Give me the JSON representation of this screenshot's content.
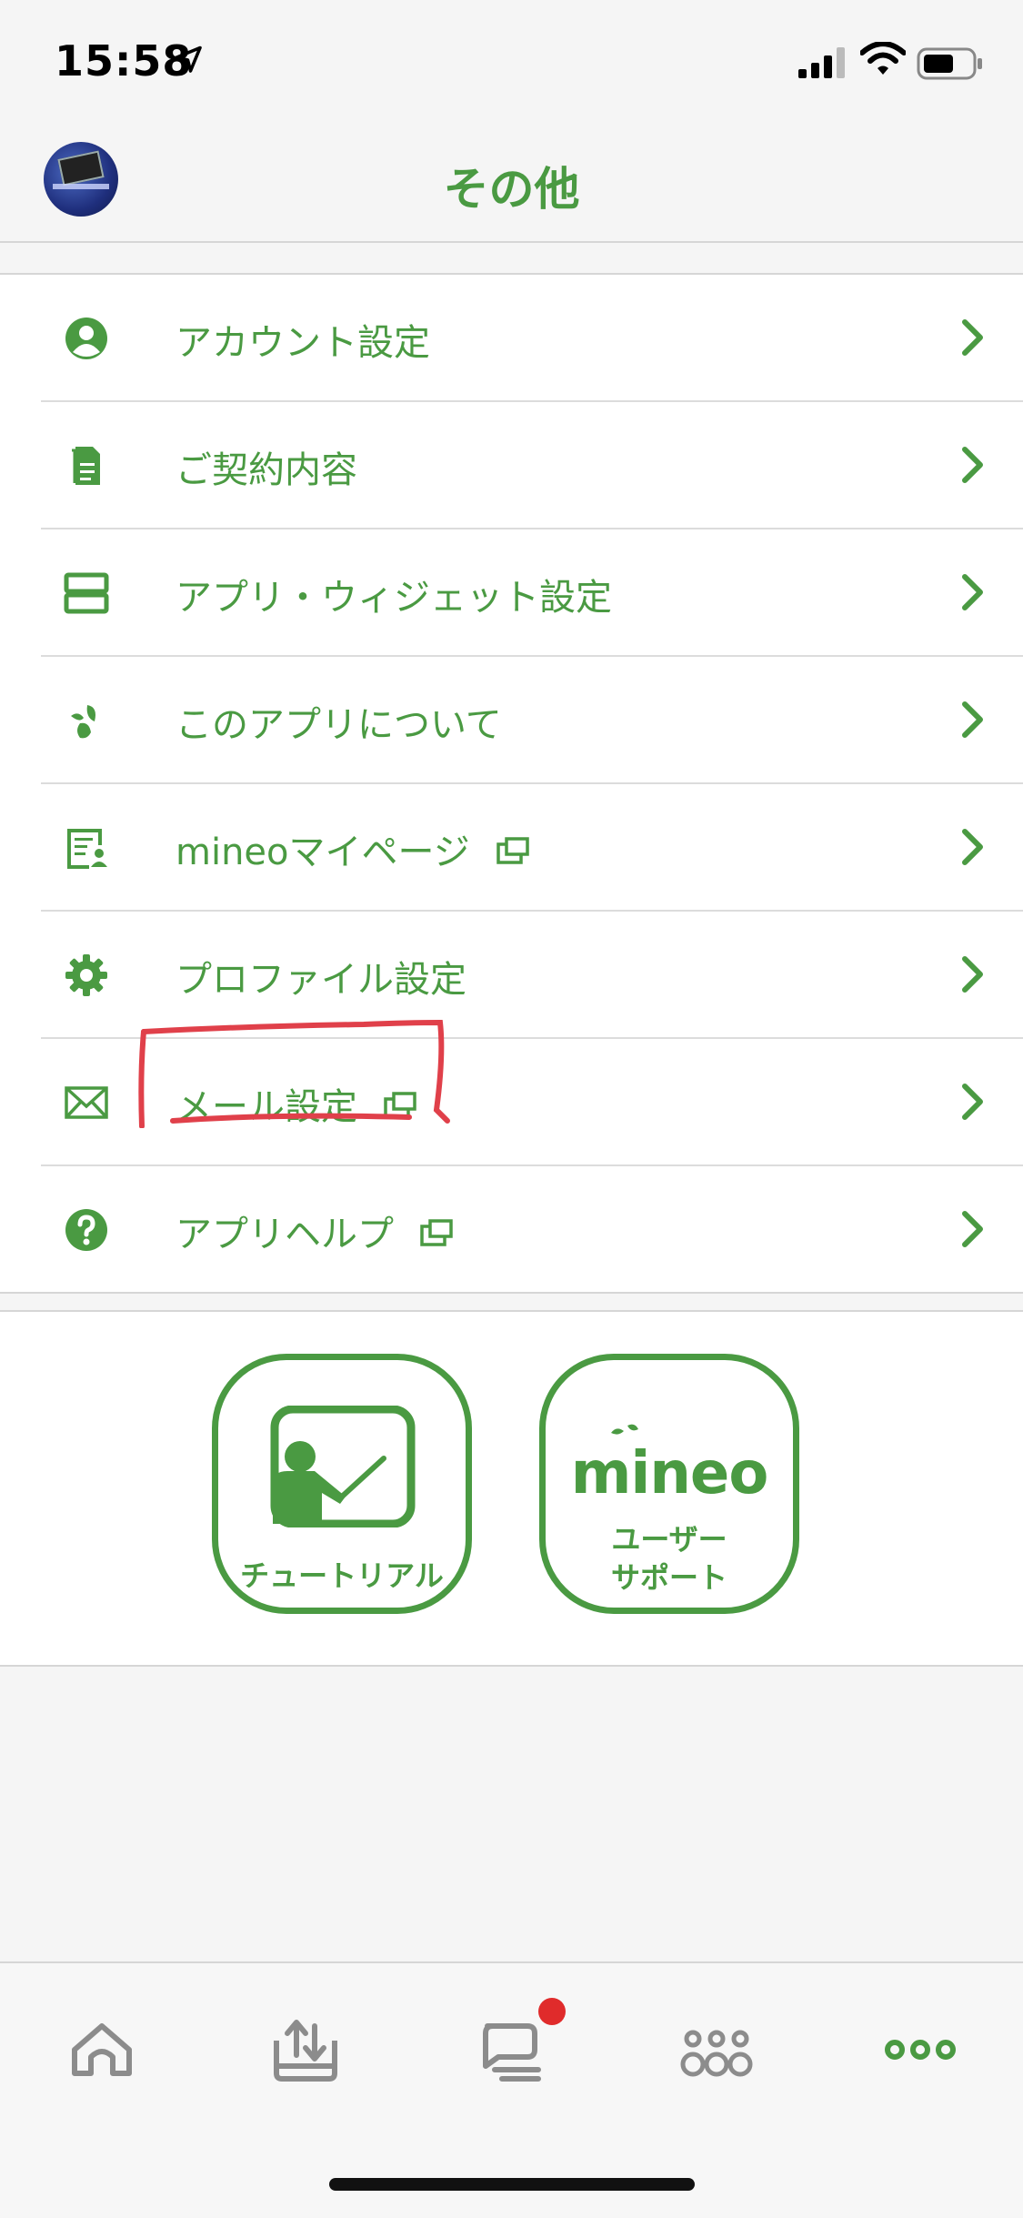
{
  "status_bar": {
    "time": "15:58"
  },
  "header": {
    "title": "その他"
  },
  "menu": {
    "items": [
      {
        "label": "アカウント設定",
        "icon": "account-icon",
        "external": false
      },
      {
        "label": "ご契約内容",
        "icon": "contract-document-icon",
        "external": false
      },
      {
        "label": "アプリ・ウィジェット設定",
        "icon": "widget-icon",
        "external": false
      },
      {
        "label": "このアプリについて",
        "icon": "mineo-leaf-icon",
        "external": false
      },
      {
        "label": "mineoマイページ",
        "icon": "mypage-icon",
        "external": true
      },
      {
        "label": "プロファイル設定",
        "icon": "gear-icon",
        "external": false
      },
      {
        "label": "メール設定",
        "icon": "mail-icon",
        "external": true
      },
      {
        "label": "アプリヘルプ",
        "icon": "help-icon",
        "external": true
      }
    ]
  },
  "shortcuts": {
    "tutorial_label": "チュートリアル",
    "support_logo": "mineo",
    "support_label_line1": "ユーザー",
    "support_label_line2": "サポート"
  },
  "tabbar": {
    "tabs": [
      "home-icon",
      "upload-tray-icon",
      "chat-icon",
      "community-icon",
      "more-icon"
    ],
    "active_tab": "more-icon",
    "badge_on": "chat-icon"
  },
  "colors": {
    "accent": "#4a9a42",
    "badge": "#e02b2b",
    "highlight": "#e0404a"
  }
}
